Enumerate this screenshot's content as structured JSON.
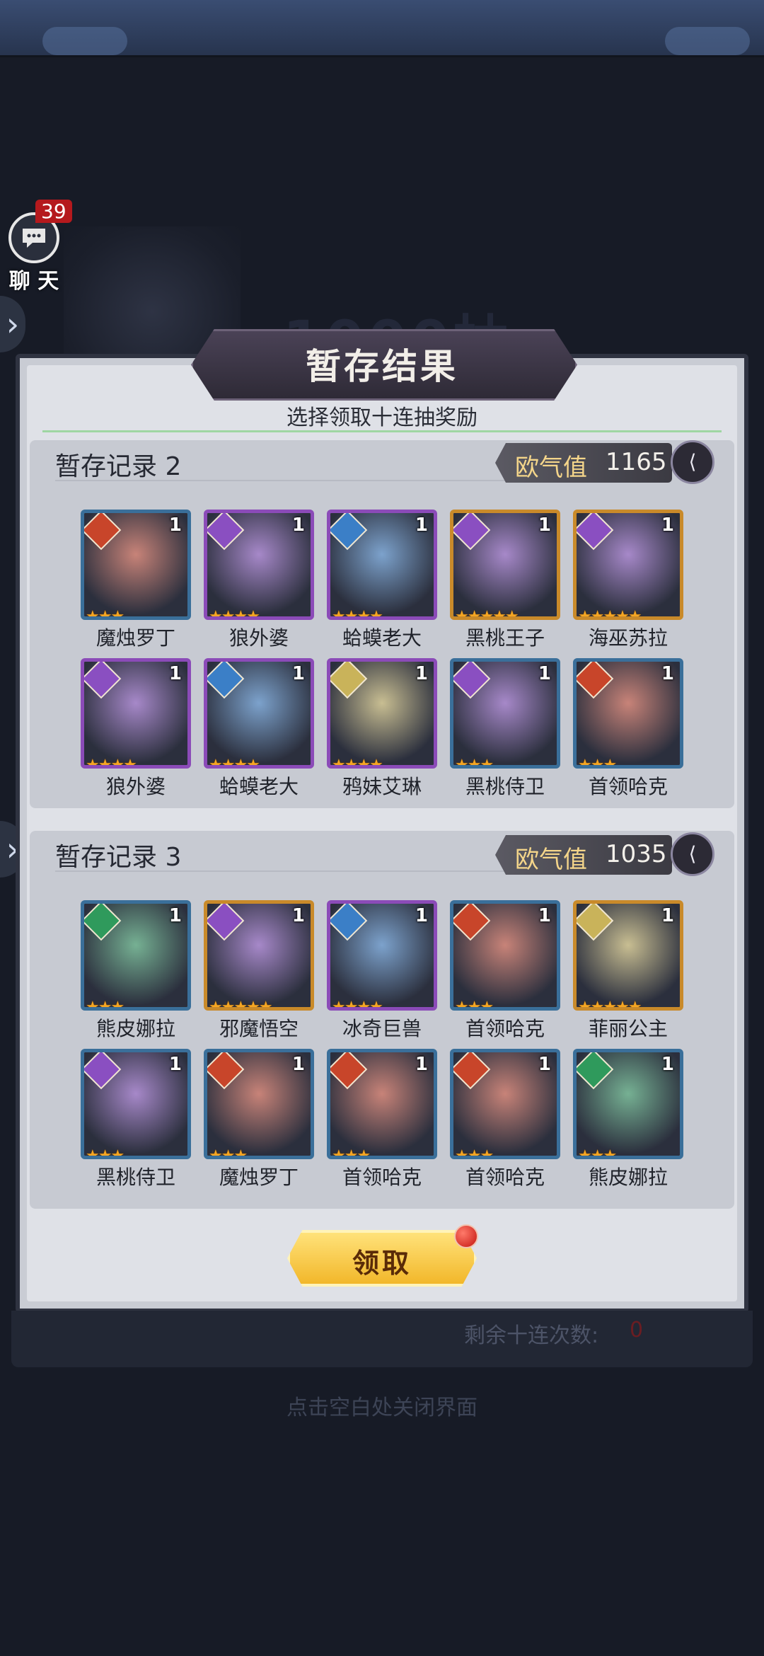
{
  "chat": {
    "badge": "39",
    "label": "聊 天"
  },
  "background_title": "1000抽",
  "panel": {
    "title": "暂存结果",
    "subtitle": "选择领取十连抽奖励"
  },
  "records": [
    {
      "title": "暂存记录 2",
      "luck_label": "欧气值",
      "luck_value": "1165",
      "heroes": [
        {
          "name": "魔烛罗丁",
          "level": "1",
          "stars": "★★★",
          "element": "fire"
        },
        {
          "name": "狼外婆",
          "level": "1",
          "stars": "★★★★",
          "element": "moon"
        },
        {
          "name": "蛤蟆老大",
          "level": "1",
          "stars": "★★★★",
          "element": "water"
        },
        {
          "name": "黑桃王子",
          "level": "1",
          "stars": "★★★★★",
          "element": "moon"
        },
        {
          "name": "海巫苏拉",
          "level": "1",
          "stars": "★★★★★",
          "element": "moon"
        },
        {
          "name": "狼外婆",
          "level": "1",
          "stars": "★★★★",
          "element": "moon"
        },
        {
          "name": "蛤蟆老大",
          "level": "1",
          "stars": "★★★★",
          "element": "water"
        },
        {
          "name": "鸦妹艾琳",
          "level": "1",
          "stars": "★★★★",
          "element": "light"
        },
        {
          "name": "黑桃侍卫",
          "level": "1",
          "stars": "★★★",
          "element": "moon"
        },
        {
          "name": "首领哈克",
          "level": "1",
          "stars": "★★★",
          "element": "fire"
        }
      ]
    },
    {
      "title": "暂存记录 3",
      "luck_label": "欧气值",
      "luck_value": "1035",
      "heroes": [
        {
          "name": "熊皮娜拉",
          "level": "1",
          "stars": "★★★",
          "element": "nature"
        },
        {
          "name": "邪魔悟空",
          "level": "1",
          "stars": "★★★★★",
          "element": "moon"
        },
        {
          "name": "冰奇巨兽",
          "level": "1",
          "stars": "★★★★",
          "element": "water"
        },
        {
          "name": "首领哈克",
          "level": "1",
          "stars": "★★★",
          "element": "fire"
        },
        {
          "name": "菲丽公主",
          "level": "1",
          "stars": "★★★★★",
          "element": "light"
        },
        {
          "name": "黑桃侍卫",
          "level": "1",
          "stars": "★★★",
          "element": "moon"
        },
        {
          "name": "魔烛罗丁",
          "level": "1",
          "stars": "★★★",
          "element": "fire"
        },
        {
          "name": "首领哈克",
          "level": "1",
          "stars": "★★★",
          "element": "fire"
        },
        {
          "name": "首领哈克",
          "level": "1",
          "stars": "★★★",
          "element": "fire"
        },
        {
          "name": "熊皮娜拉",
          "level": "1",
          "stars": "★★★",
          "element": "nature"
        }
      ]
    }
  ],
  "claim_button": "领取",
  "remaining": {
    "label": "剩余十连次数:",
    "value": "0"
  },
  "close_hint": "点击空白处关闭界面",
  "colors": {
    "fire": "#c8452a",
    "moon": "#8a4fc1",
    "water": "#3b7fc7",
    "light": "#c9b35a",
    "nature": "#2f9a5c",
    "frame_blue": "#3a6f9a",
    "frame_purple": "#8b4bb8",
    "frame_gold": "#c98a2a"
  }
}
